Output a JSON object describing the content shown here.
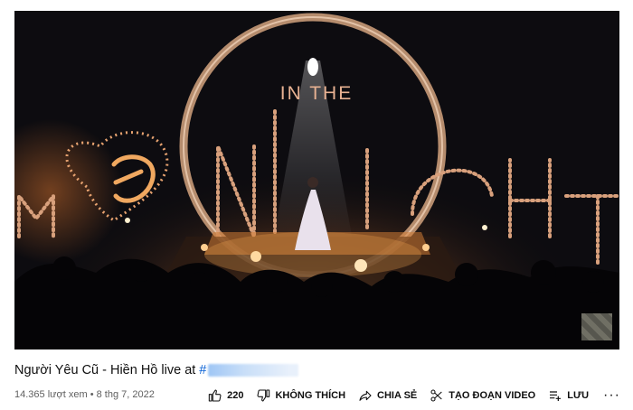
{
  "video": {
    "title": "Người Yêu Cũ - Hiền Hồ live at",
    "title_hashtag": "#",
    "views": "14.365 lượt xem",
    "date": "8 thg 7, 2022",
    "stage_text_top": "IN THE",
    "stage_text_bottom": "MOONLIGHT"
  },
  "actions": {
    "like_count": "220",
    "dislike_label": "KHÔNG THÍCH",
    "share_label": "CHIA SẺ",
    "clip_label": "TẠO ĐOẠN VIDEO",
    "save_label": "LƯU",
    "more_label": "···"
  },
  "icons": {
    "like": "thumbs-up-icon",
    "dislike": "thumbs-down-icon",
    "share": "share-arrow-icon",
    "clip": "scissors-icon",
    "save": "playlist-add-icon"
  }
}
